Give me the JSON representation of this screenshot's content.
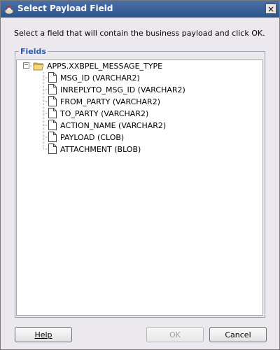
{
  "dialog": {
    "title": "Select Payload Field",
    "close_glyph": "×"
  },
  "instruction": "Select a field that will contain the business payload and click OK.",
  "fields": {
    "legend": "Fields",
    "root": {
      "label": "APPS.XXBPEL_MESSAGE_TYPE",
      "expanded": true,
      "expander_glyph": "−"
    },
    "children": [
      {
        "label": "MSG_ID (VARCHAR2)"
      },
      {
        "label": "INREPLYTO_MSG_ID (VARCHAR2)"
      },
      {
        "label": "FROM_PARTY (VARCHAR2)"
      },
      {
        "label": "TO_PARTY (VARCHAR2)"
      },
      {
        "label": "ACTION_NAME (VARCHAR2)"
      },
      {
        "label": "PAYLOAD (CLOB)"
      },
      {
        "label": "ATTACHMENT (BLOB)"
      }
    ]
  },
  "buttons": {
    "help": "Help",
    "ok": "OK",
    "cancel": "Cancel"
  },
  "colors": {
    "title_bar": "#2f558c",
    "legend": "#2a5db0",
    "disabled_text": "#a0a0a0"
  },
  "icons": {
    "title": "oracle-jdeveloper-icon",
    "folder": "open-folder-icon",
    "file": "document-icon"
  }
}
